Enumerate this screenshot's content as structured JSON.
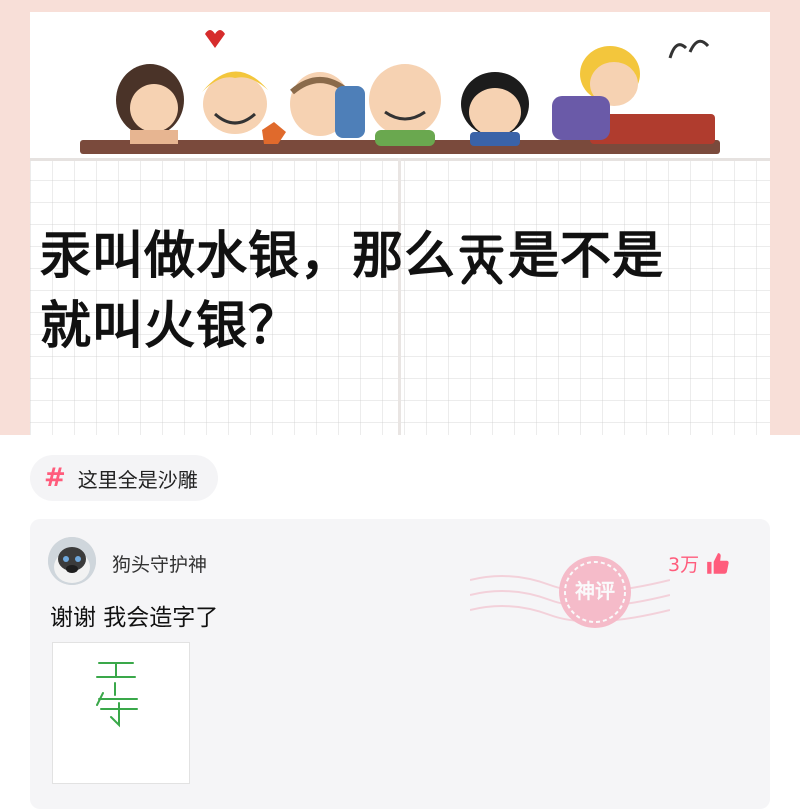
{
  "post": {
    "headline_line1": "汞叫做水银，那么",
    "headline_glyph": "汞",
    "headline_line1_end": "是不是",
    "headline_line2": "就叫火银？"
  },
  "tag": {
    "icon": "hash-icon",
    "label": "这里全是沙雕"
  },
  "comment": {
    "username": "狗头守护神",
    "likes": "3万",
    "text": "谢谢 我会造字了",
    "stamp_label": "神评"
  },
  "colors": {
    "accent": "#ff5c7c",
    "pink_bg": "#f8dfd8",
    "card_bg": "#f5f5f7",
    "handwriting": "#3aa84a"
  }
}
